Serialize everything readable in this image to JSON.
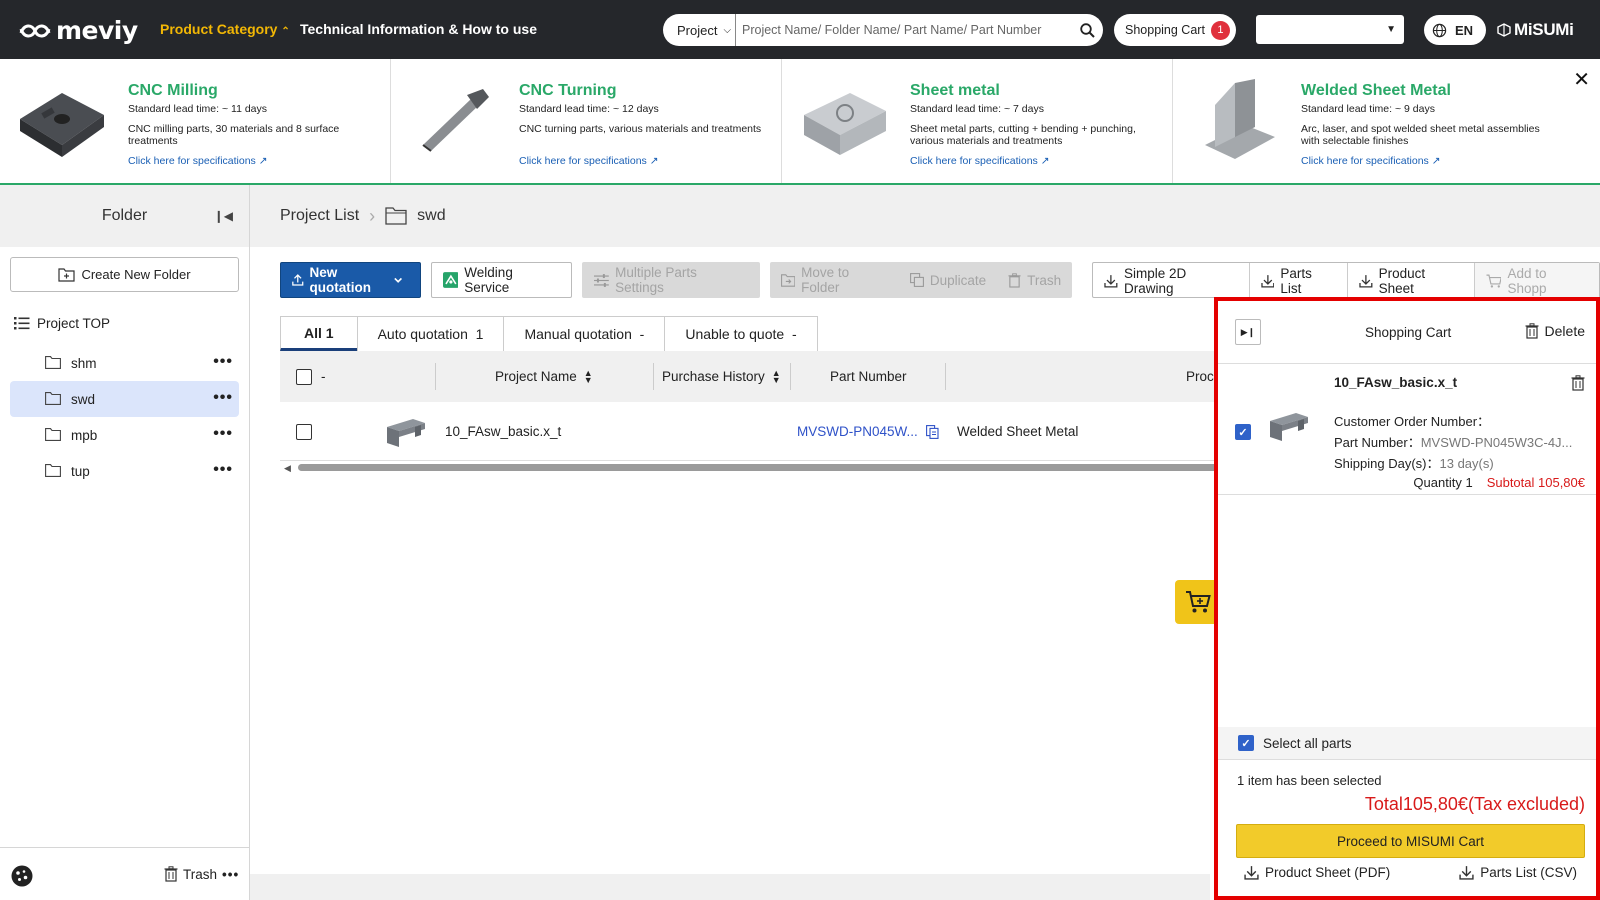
{
  "header": {
    "logo": "meviy",
    "nav_product_category": "Product Category",
    "nav_technical": "Technical Information & How to use",
    "search_scope": "Project",
    "search_placeholder": "Project Name/ Folder Name/ Part Name/ Part Number",
    "cart_label": "Shopping Cart",
    "cart_count": "1",
    "language": "EN",
    "brand": "MiSUMi"
  },
  "categories": [
    {
      "title": "CNC Milling",
      "lead": "Standard lead time: ~ 11 days",
      "desc": "CNC milling parts, 30 materials and 8 surface treatments",
      "link": "Click here for specifications"
    },
    {
      "title": "CNC Turning",
      "lead": "Standard lead time: ~ 12 days",
      "desc": "CNC turning parts, various materials and treatments",
      "link": "Click here for specifications"
    },
    {
      "title": "Sheet metal",
      "lead": "Standard lead time: ~ 7 days",
      "desc": "Sheet metal parts, cutting + bending + punching, various materials and treatments",
      "link": "Click here for specifications"
    },
    {
      "title": "Welded Sheet Metal",
      "lead": "Standard lead time: ~ 9 days",
      "desc": "Arc, laser, and spot welded sheet metal assemblies with selectable finishes",
      "link": "Click here for specifications"
    }
  ],
  "sidebar": {
    "title": "Folder",
    "create_folder": "Create New Folder",
    "project_top": "Project TOP",
    "folders": [
      {
        "name": "shm"
      },
      {
        "name": "swd"
      },
      {
        "name": "mpb"
      },
      {
        "name": "tup"
      }
    ],
    "trash": "Trash"
  },
  "breadcrumb": {
    "root": "Project List",
    "current": "swd"
  },
  "toolbar": {
    "new_quotation": "New quotation",
    "welding_service": "Welding Service",
    "multiple_parts": "Multiple Parts Settings",
    "move_to_folder": "Move to Folder",
    "duplicate": "Duplicate",
    "trash": "Trash",
    "simple_2d": "Simple 2D Drawing",
    "parts_list": "Parts List",
    "product_sheet": "Product Sheet",
    "add_to_cart": "Add to Shopp"
  },
  "tabs": [
    {
      "label": "All",
      "count": "1"
    },
    {
      "label": "Auto quotation",
      "count": "1"
    },
    {
      "label": "Manual quotation",
      "count": "-"
    },
    {
      "label": "Unable to quote",
      "count": "-"
    }
  ],
  "table": {
    "select_label": "-",
    "headers": {
      "project_name": "Project Name",
      "purchase_history": "Purchase History",
      "part_number": "Part Number",
      "process": "Proc"
    },
    "rows": [
      {
        "project_name": "10_FAsw_basic.x_t",
        "part_number": "MVSWD-PN045W...",
        "process": "Welded Sheet Metal"
      }
    ]
  },
  "cart_panel": {
    "title": "Shopping Cart",
    "delete": "Delete",
    "item": {
      "name": "10_FAsw_basic.x_t",
      "order_label": "Customer Order Number：",
      "part_label": "Part Number：",
      "part_value": "MVSWD-PN045W3C-4J...",
      "shipping_label": "Shipping Day(s)：",
      "shipping_value": "13 day(s)",
      "quantity": "Quantity 1",
      "subtotal": "Subtotal 105,80€"
    },
    "select_all": "Select all parts",
    "selected_text": "1 item has been selected",
    "total": "Total105,80€(Tax excluded)",
    "proceed": "Proceed to MISUMI Cart",
    "product_sheet_pdf": "Product Sheet (PDF)",
    "parts_list_csv": "Parts List (CSV)"
  },
  "colors": {
    "topbar": "#25272b",
    "accent_yellow": "#f2b705",
    "category_green": "#2aa868",
    "primary_blue": "#1a5aa8",
    "price_red": "#d81a1a",
    "highlight_red": "#e40000"
  }
}
